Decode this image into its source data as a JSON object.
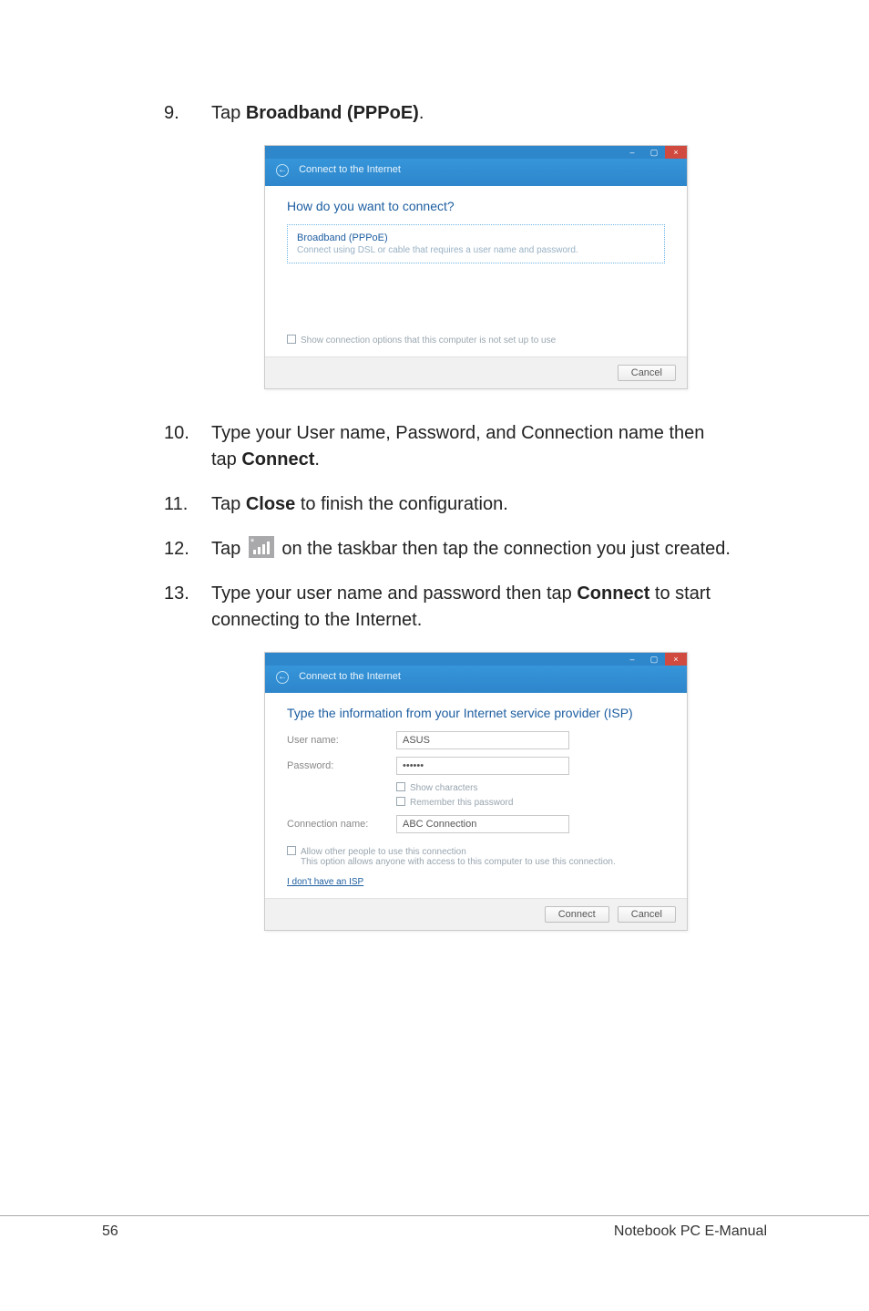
{
  "steps": {
    "s9": {
      "num": "9.",
      "pre": "Tap ",
      "bold": "Broadband (PPPoE)",
      "post": "."
    },
    "s10": {
      "num": "10.",
      "pre": "Type your User name, Password, and Connection name then tap ",
      "bold": "Connect",
      "post": "."
    },
    "s11": {
      "num": "11.",
      "pre": "Tap ",
      "bold": "Close",
      "post": " to finish the configuration."
    },
    "s12": {
      "num": "12.",
      "pre": "Tap ",
      "post": " on the taskbar then tap the connection you just created."
    },
    "s13": {
      "num": "13.",
      "pre": "Type your user name and password then tap ",
      "bold": "Connect",
      "post": " to start connecting to the Internet."
    }
  },
  "shot1": {
    "title": "Connect to the Internet",
    "heading": "How do you want to connect?",
    "option_title": "Broadband (PPPoE)",
    "option_sub": "Connect using DSL or cable that requires a user name and password.",
    "check_label": "Show connection options that this computer is not set up to use",
    "cancel": "Cancel"
  },
  "shot2": {
    "title": "Connect to the Internet",
    "heading": "Type the information from your Internet service provider (ISP)",
    "username_label": "User name:",
    "username_value": "ASUS",
    "password_label": "Password:",
    "password_value": "••••••",
    "show_chars": "Show characters",
    "remember": "Remember this password",
    "connname_label": "Connection name:",
    "connname_value": "ABC Connection",
    "allow": "Allow other people to use this connection",
    "allow_sub": "This option allows anyone with access to this computer to use this connection.",
    "noisp": "I don't have an ISP",
    "connect": "Connect",
    "cancel": "Cancel"
  },
  "footer": {
    "page": "56",
    "label": "Notebook PC E-Manual"
  }
}
